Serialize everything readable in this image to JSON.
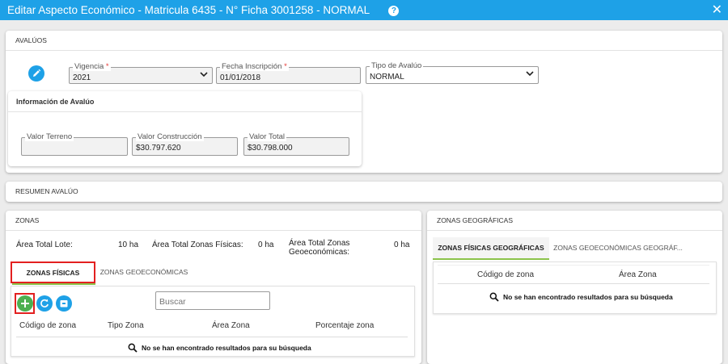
{
  "window": {
    "title": "Editar Aspecto Económico - Matricula 6435 - N° Ficha 3001258 - NORMAL",
    "help_icon": "question-circle-icon",
    "close_icon": "close-icon"
  },
  "avaluos": {
    "header": "AVALÚOS",
    "vigencia": {
      "label": "Vigencia",
      "required_mark": "*",
      "value": "2021"
    },
    "fecha_inscripcion": {
      "label": "Fecha Inscripción",
      "required_mark": "*",
      "value": "01/01/2018"
    },
    "tipo_avaluo": {
      "label": "Tipo de Avalúo",
      "value": "NORMAL"
    },
    "informacion": {
      "header": "Información de Avalúo",
      "valor_terreno": {
        "label": "Valor Terreno",
        "value": ""
      },
      "valor_construccion": {
        "label": "Valor Construcción",
        "value": "$30.797.620"
      },
      "valor_total": {
        "label": "Valor Total",
        "value": "$30.798.000"
      }
    }
  },
  "resumen": {
    "header": "RESUMEN AVALÚO"
  },
  "zonas": {
    "header": "ZONAS",
    "area_total_lote": {
      "label": "Área Total Lote:",
      "value": "10 ha"
    },
    "area_total_fisicas": {
      "label": "Área Total Zonas Físicas:",
      "value": "0 ha"
    },
    "area_total_geoeconomicas": {
      "label_line1": "Área Total Zonas",
      "label_line2": "Geoeconómicas:",
      "value": "0 ha"
    },
    "tabs": [
      "ZONAS FÍSICAS",
      "ZONAS GEOECONÓMICAS"
    ],
    "active_tab": "ZONAS FÍSICAS",
    "search_placeholder": "Buscar",
    "columns": [
      "Código de zona",
      "Tipo Zona",
      "Área Zona",
      "Porcentaje zona"
    ],
    "empty_message": "No se han encontrado resultados para su búsqueda"
  },
  "geo": {
    "header": "ZONAS GEOGRÁFICAS",
    "tabs": [
      "ZONAS FÍSICAS GEOGRÁFICAS",
      "ZONAS GEOECONÓMICAS GEOGRÁF..."
    ],
    "active_tab": "ZONAS FÍSICAS GEOGRÁFICAS",
    "columns": [
      "Código de zona",
      "Área Zona"
    ],
    "empty_message": "No se han encontrado resultados para su búsqueda"
  },
  "colors": {
    "primary": "#1ea1e7",
    "success": "#4caf50",
    "highlight": "#e32020",
    "active_tab_underline": "#8bc34a"
  }
}
